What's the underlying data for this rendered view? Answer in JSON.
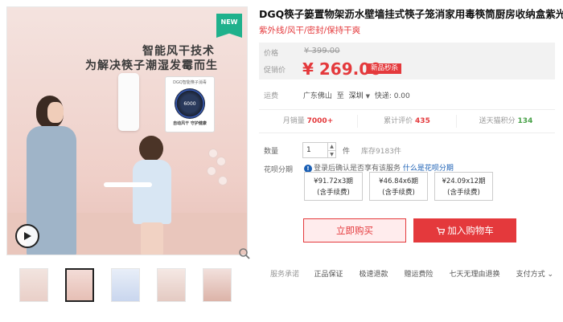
{
  "gallery": {
    "badge": "NEW",
    "hero_line1": "智能风干技术",
    "hero_line2": "为解决筷子潮湿发霉而生",
    "device_card_title": "DGQ智能筷子消毒",
    "device_card_value": "6000",
    "device_card_sub": "自动风干 守护健康",
    "thumbnails": [
      "thumb-1",
      "thumb-2",
      "thumb-3",
      "thumb-4",
      "thumb-5"
    ],
    "active_thumbnail": 2
  },
  "product": {
    "title": "DGQ筷子篓置物架沥水壁墙挂式筷子笼消家用毒筷筒厨房收纳盒紫光",
    "subtitle": "紫外线/风干/密封/保持干爽"
  },
  "price": {
    "orig_label": "价格",
    "orig_value": "¥ 399.00",
    "promo_label": "促销价",
    "promo_value": "¥ 269.00",
    "promo_badge": "新品秒杀"
  },
  "shipping": {
    "label": "运费",
    "from": "广东佛山",
    "to_word": "至",
    "to": "深圳",
    "express": "快递: 0.00"
  },
  "stats": {
    "monthly_label": "月销量",
    "monthly_value": "7000+",
    "reviews_label": "累计评价",
    "reviews_value": "435",
    "points_label": "送天猫积分",
    "points_value": "134"
  },
  "quantity": {
    "label": "数量",
    "value": "1",
    "unit": "件",
    "stock": "库存9183件"
  },
  "installment": {
    "label": "花呗分期",
    "note_prefix": "登录后确认是否享有该服务",
    "note_link": "什么是花呗分期",
    "plans": [
      {
        "line1": "¥91.72x3期",
        "line2": "(含手续费)"
      },
      {
        "line1": "¥46.84x6期",
        "line2": "(含手续费)"
      },
      {
        "line1": "¥24.09x12期",
        "line2": "(含手续费)"
      }
    ]
  },
  "actions": {
    "buy_now": "立即购买",
    "add_to_cart": "加入购物车"
  },
  "services": {
    "label": "服务承诺",
    "items": [
      "正品保证",
      "极速退款",
      "赠运费险",
      "七天无理由退换"
    ],
    "payment": "支付方式"
  },
  "colors": {
    "accent": "#e4393c",
    "badge_green": "#1fb18c",
    "points_green": "#46a046",
    "link_blue": "#1a5fb4"
  }
}
